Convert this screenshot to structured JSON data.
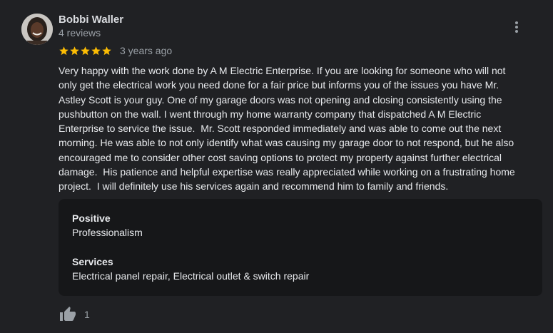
{
  "review": {
    "reviewer_name": "Bobbi Waller",
    "review_count": "4 reviews",
    "rating": 5,
    "rating_max": 5,
    "time_ago": "3 years ago",
    "text": "Very happy with the work done by A M Electric Enterprise. If you are looking for someone who will not\nonly get the electrical work you need done for a fair price but informs you of the issues you have Mr.\nAstley Scott is your guy. One of my garage doors was not opening and closing consistently using the\npushbutton on the wall. I went through my home warranty company that dispatched A M Electric\nEnterprise to service the issue.  Mr. Scott responded immediately and was able to come out the next\nmorning. He was able to not only identify what was causing my garage door to not respond, but he also\nencouraged me to consider other cost saving options to protect my property against further electrical\ndamage.  His patience and helpful expertise was really appreciated while working on a frustrating home\nproject.  I will definitely use his services again and recommend him to family and friends.",
    "attributes": {
      "positive": {
        "title": "Positive",
        "value": "Professionalism"
      },
      "services": {
        "title": "Services",
        "value": "Electrical panel repair, Electrical outlet & switch repair"
      }
    },
    "likes": "1"
  },
  "icons": {
    "avatar": "reviewer-photo",
    "more": "more-vert-icon",
    "star": "star-icon",
    "like": "thumb-up-icon"
  },
  "colors": {
    "background": "#202124",
    "panel": "#161719",
    "star": "#fbbc04",
    "text": "#e8eaed",
    "secondary_text": "#9aa0a6",
    "icon": "#9aa0a6"
  }
}
